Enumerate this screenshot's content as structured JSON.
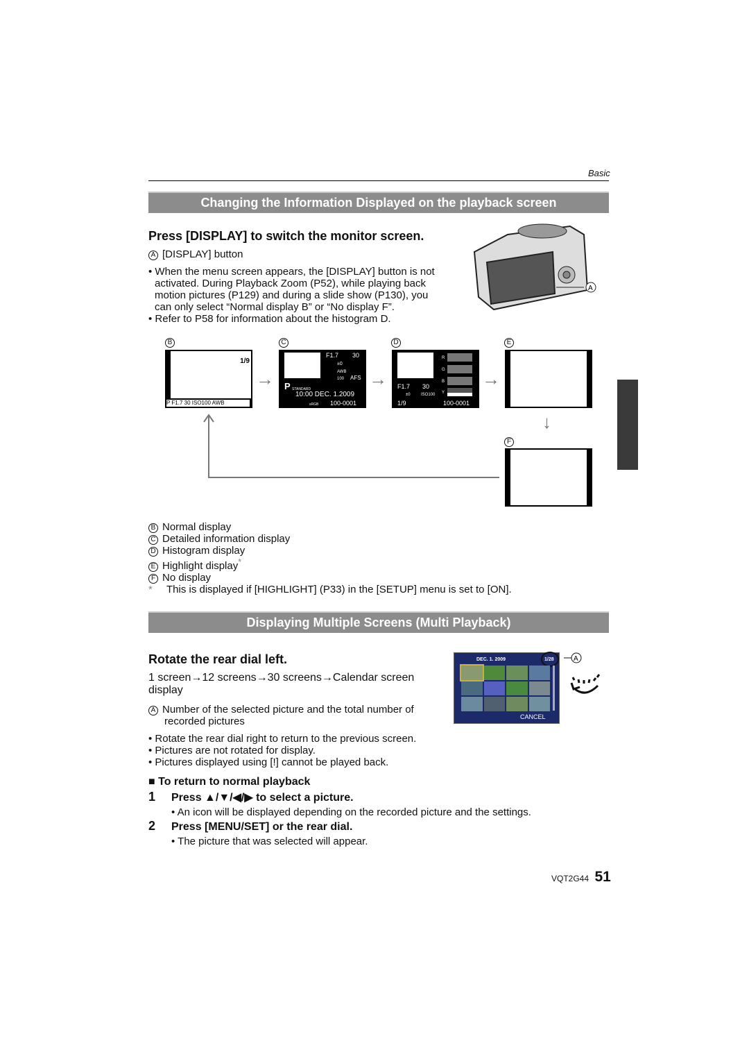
{
  "header": {
    "section": "Basic"
  },
  "section1": {
    "title": "Changing the Information Displayed on the playback screen",
    "heading": "Press [DISPLAY] to switch the monitor screen.",
    "callout_a": {
      "letter": "A",
      "text": "[DISPLAY] button"
    },
    "bullets": [
      "When the menu screen appears, the [DISPLAY] button is not",
      "activated. During Playback Zoom (P52), while playing back",
      "motion pictures (P129) and during a slide show (P130), you",
      "can only select “Normal display B” or “No display F”.",
      "Refer to P58 for information about the histogram D."
    ],
    "screens": {
      "B": {
        "letter": "B",
        "top_right": "1/9",
        "bottom": "P  F1.7  30  ISO100  AWB"
      },
      "C": {
        "letter": "C",
        "aperture": "F1.7",
        "shutter": "30",
        "ev": "±0",
        "wb": "AWB",
        "iso": "100",
        "focus": "AFS",
        "mode": "P",
        "style": "STANDARD",
        "datetime": "10:00  DEC. 1.2009",
        "color": "sRGB",
        "file": "100-0001"
      },
      "D": {
        "letter": "D",
        "channels": [
          "R",
          "G",
          "B",
          "Y"
        ],
        "aperture": "F1.7",
        "shutter": "30",
        "ev": "±0",
        "iso": "ISO100",
        "count": "1/9",
        "file": "100-0001"
      },
      "E": {
        "letter": "E"
      },
      "F": {
        "letter": "F"
      }
    },
    "legend": [
      {
        "letter": "B",
        "text": "Normal display"
      },
      {
        "letter": "C",
        "text": "Detailed information display"
      },
      {
        "letter": "D",
        "text": "Histogram display"
      },
      {
        "letter": "E",
        "text": "Highlight display",
        "mark": "*"
      },
      {
        "letter": "F",
        "text": "No display"
      }
    ],
    "footnote": {
      "mark": "*",
      "text": "This is displayed if [HIGHLIGHT] (P33) in the [SETUP] menu is set to [ON]."
    }
  },
  "section2": {
    "title": "Displaying Multiple Screens (Multi Playback)",
    "heading": "Rotate the rear dial left.",
    "sequence_line1": "1 screen→12 screens→30 screens→Calendar screen",
    "sequence_line2": "display",
    "callout_a": {
      "letter": "A",
      "line1": "Number of the selected picture and the total number of",
      "line2": "recorded pictures"
    },
    "bullets": [
      "Rotate the rear dial right to return to the previous screen.",
      "Pictures are not rotated for display.",
      "Pictures displayed using [!] cannot be played back."
    ],
    "multi_screen": {
      "date": "DEC. 1. 2009",
      "count": "1/28",
      "cancel": "CANCEL"
    },
    "subheading": "To return to normal playback",
    "steps": [
      {
        "num": "1",
        "text": "Press ▲/▼/◀/▶ to select a picture.",
        "note": "An icon will be displayed depending on the recorded picture and the settings."
      },
      {
        "num": "2",
        "text": "Press [MENU/SET] or the rear dial.",
        "note": "The picture that was selected will appear."
      }
    ]
  },
  "footer": {
    "code": "VQT2G44",
    "page": "51"
  }
}
